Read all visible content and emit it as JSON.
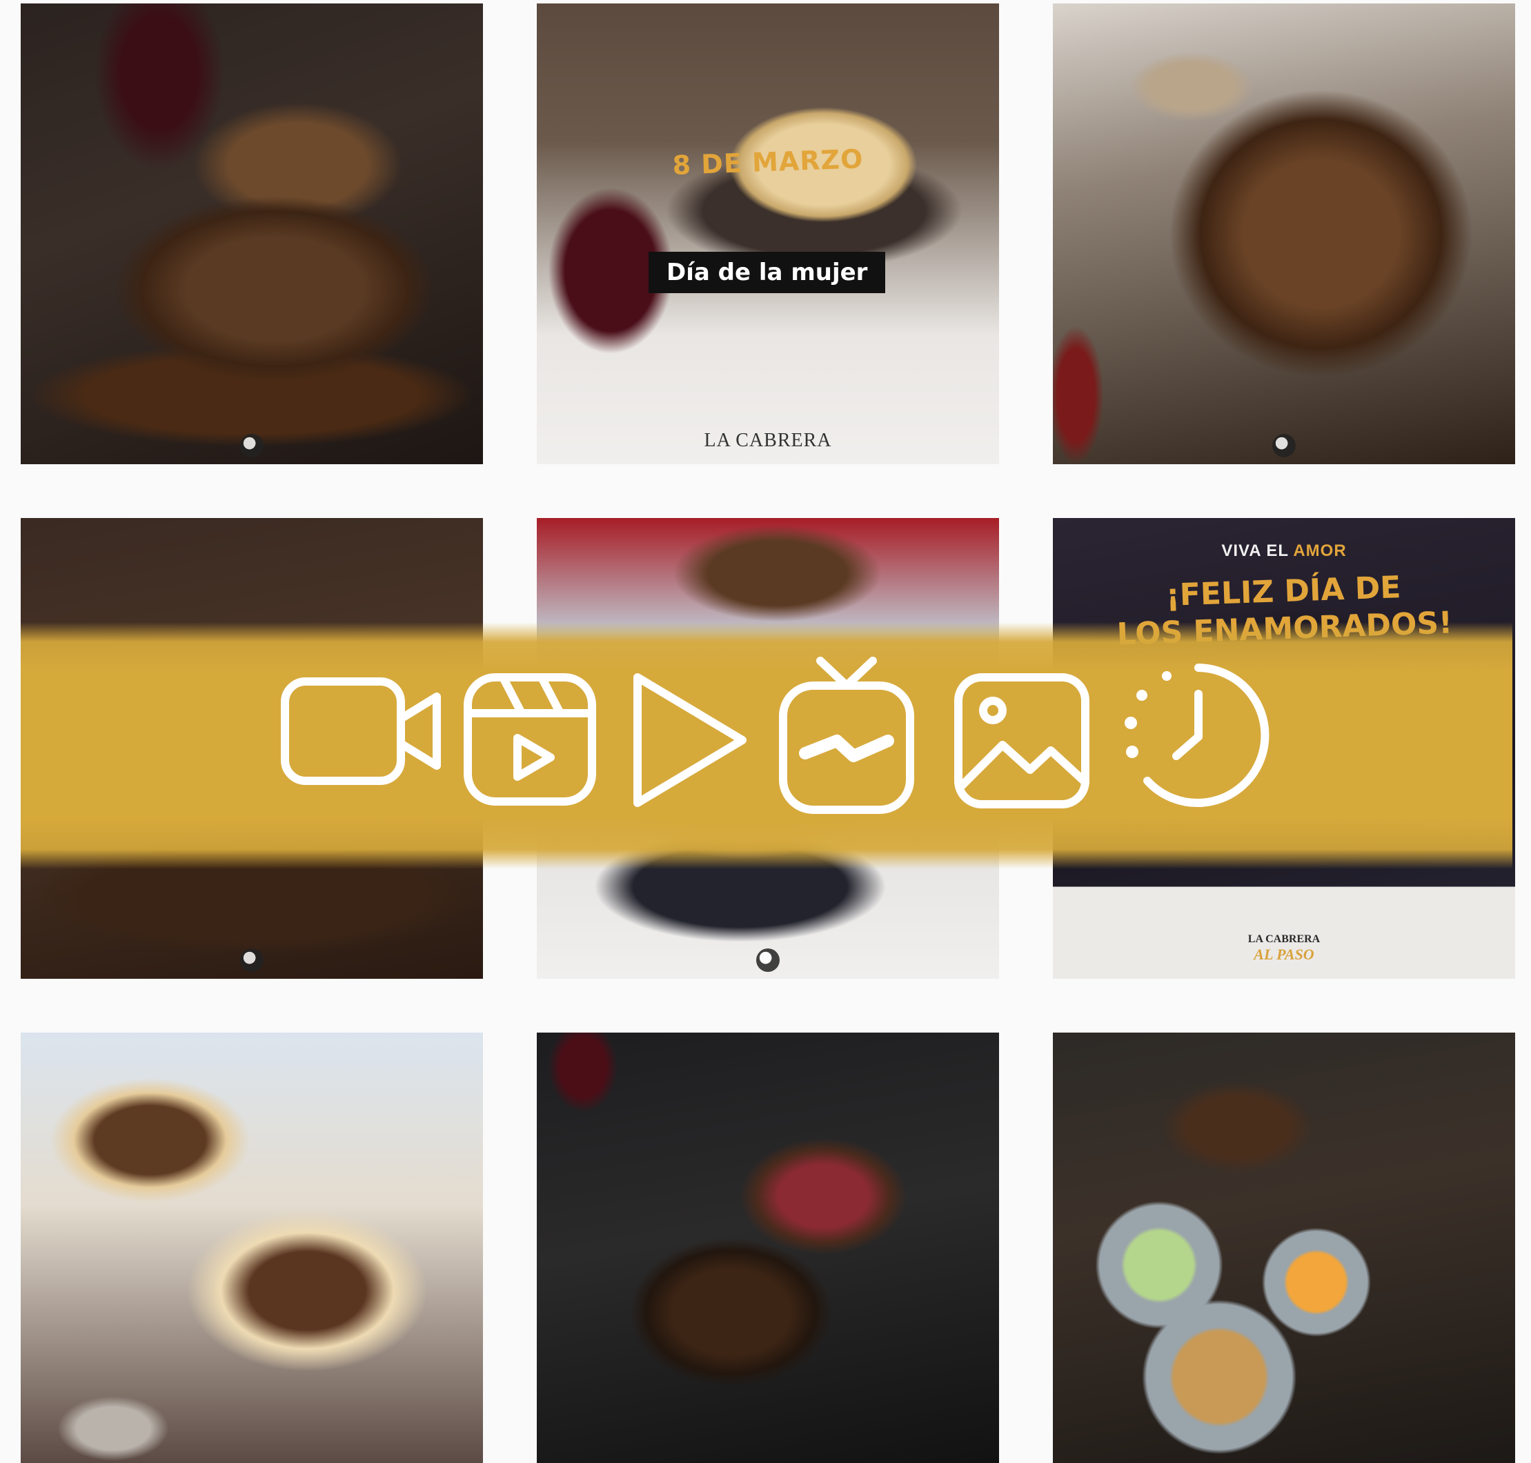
{
  "tiles": [
    {
      "id": "steak-on-board",
      "row": 1,
      "col": 1
    },
    {
      "id": "dia-de-la-mujer",
      "row": 1,
      "col": 2,
      "caption_gold": "8 DE MARZO",
      "caption_box": "Día de la mujer",
      "brand": "LA CABRERA"
    },
    {
      "id": "beef-ribs",
      "row": 1,
      "col": 3
    },
    {
      "id": "grill-plate",
      "row": 2,
      "col": 1
    },
    {
      "id": "fries-pan",
      "row": 2,
      "col": 2
    },
    {
      "id": "enamorados-promo",
      "row": 2,
      "col": 3,
      "top_prefix": "VIVA EL",
      "top_accent": "AMOR",
      "title_line1": "¡FELIZ DÍA DE",
      "title_line2": "LOS ENAMORADOS!",
      "brand": "LA CABRERA",
      "brand_sub": "AL PASO"
    },
    {
      "id": "empanadas-cut",
      "row": 3,
      "col": 1
    },
    {
      "id": "tenderloin",
      "row": 3,
      "col": 2
    },
    {
      "id": "sauces-and-meat",
      "row": 3,
      "col": 3
    }
  ],
  "banner": {
    "color": "#d6a93b",
    "icons": [
      "video-camera-icon",
      "reels-icon",
      "play-icon",
      "igtv-icon",
      "image-icon",
      "story-timer-icon"
    ]
  }
}
